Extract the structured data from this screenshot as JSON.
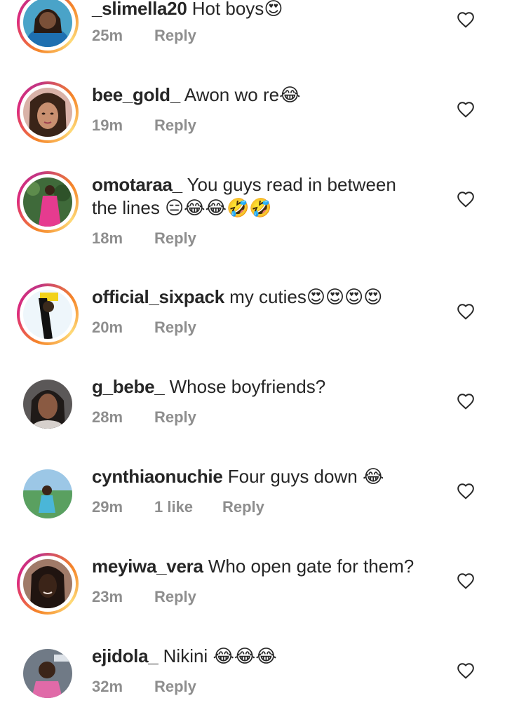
{
  "comments": [
    {
      "username": "_slimella20",
      "text": " Hot boys",
      "emoji": "😍",
      "time": "25m",
      "likes": "",
      "reply": "Reply",
      "story": true,
      "avatar_color": "#4aa3c8",
      "avatar_skin": "#6b4630"
    },
    {
      "username": "bee_gold_",
      "text": " Awon wo re",
      "emoji": "😂",
      "time": "19m",
      "likes": "",
      "reply": "Reply",
      "story": true,
      "avatar_color": "#d9b2a8",
      "avatar_skin": "#c99070"
    },
    {
      "username": "omotaraa_",
      "text": " You guys read in between the lines ",
      "emoji": "😑😂😂🤣🤣",
      "time": "18m",
      "likes": "",
      "reply": "Reply",
      "story": true,
      "avatar_color": "#3f6a3a",
      "avatar_skin": "#e63b8f"
    },
    {
      "username": "official_sixpack",
      "text": " my cuties",
      "emoji": "😍😍😍😍",
      "time": "20m",
      "likes": "",
      "reply": "Reply",
      "story": true,
      "avatar_color": "#f4f4f4",
      "avatar_skin": "#3a2a1c"
    },
    {
      "username": "g_bebe_",
      "text": " Whose boyfriends?",
      "emoji": "",
      "time": "28m",
      "likes": "",
      "reply": "Reply",
      "story": false,
      "avatar_color": "#5b5858",
      "avatar_skin": "#8a5a42"
    },
    {
      "username": "cynthiaonuchie",
      "text": " Four guys down ",
      "emoji": "😂",
      "time": "29m",
      "likes": "1 like",
      "reply": "Reply",
      "story": false,
      "avatar_color": "#5aa060",
      "avatar_skin": "#4ab6d8"
    },
    {
      "username": "meyiwa_vera",
      "text": " Who open gate for them?",
      "emoji": "",
      "time": "23m",
      "likes": "",
      "reply": "Reply",
      "story": true,
      "avatar_color": "#6e4a3a",
      "avatar_skin": "#3b2418"
    },
    {
      "username": "ejidola_",
      "text": " Nikini ",
      "emoji": "😂😂😂",
      "time": "32m",
      "likes": "",
      "reply": "Reply",
      "story": false,
      "avatar_color": "#707a86",
      "avatar_skin": "#e06aa8"
    }
  ],
  "icons": {
    "like": "heart-outline-icon"
  },
  "colors": {
    "meta": "#8e8e8e",
    "text": "#262626",
    "heart": "#262626"
  }
}
